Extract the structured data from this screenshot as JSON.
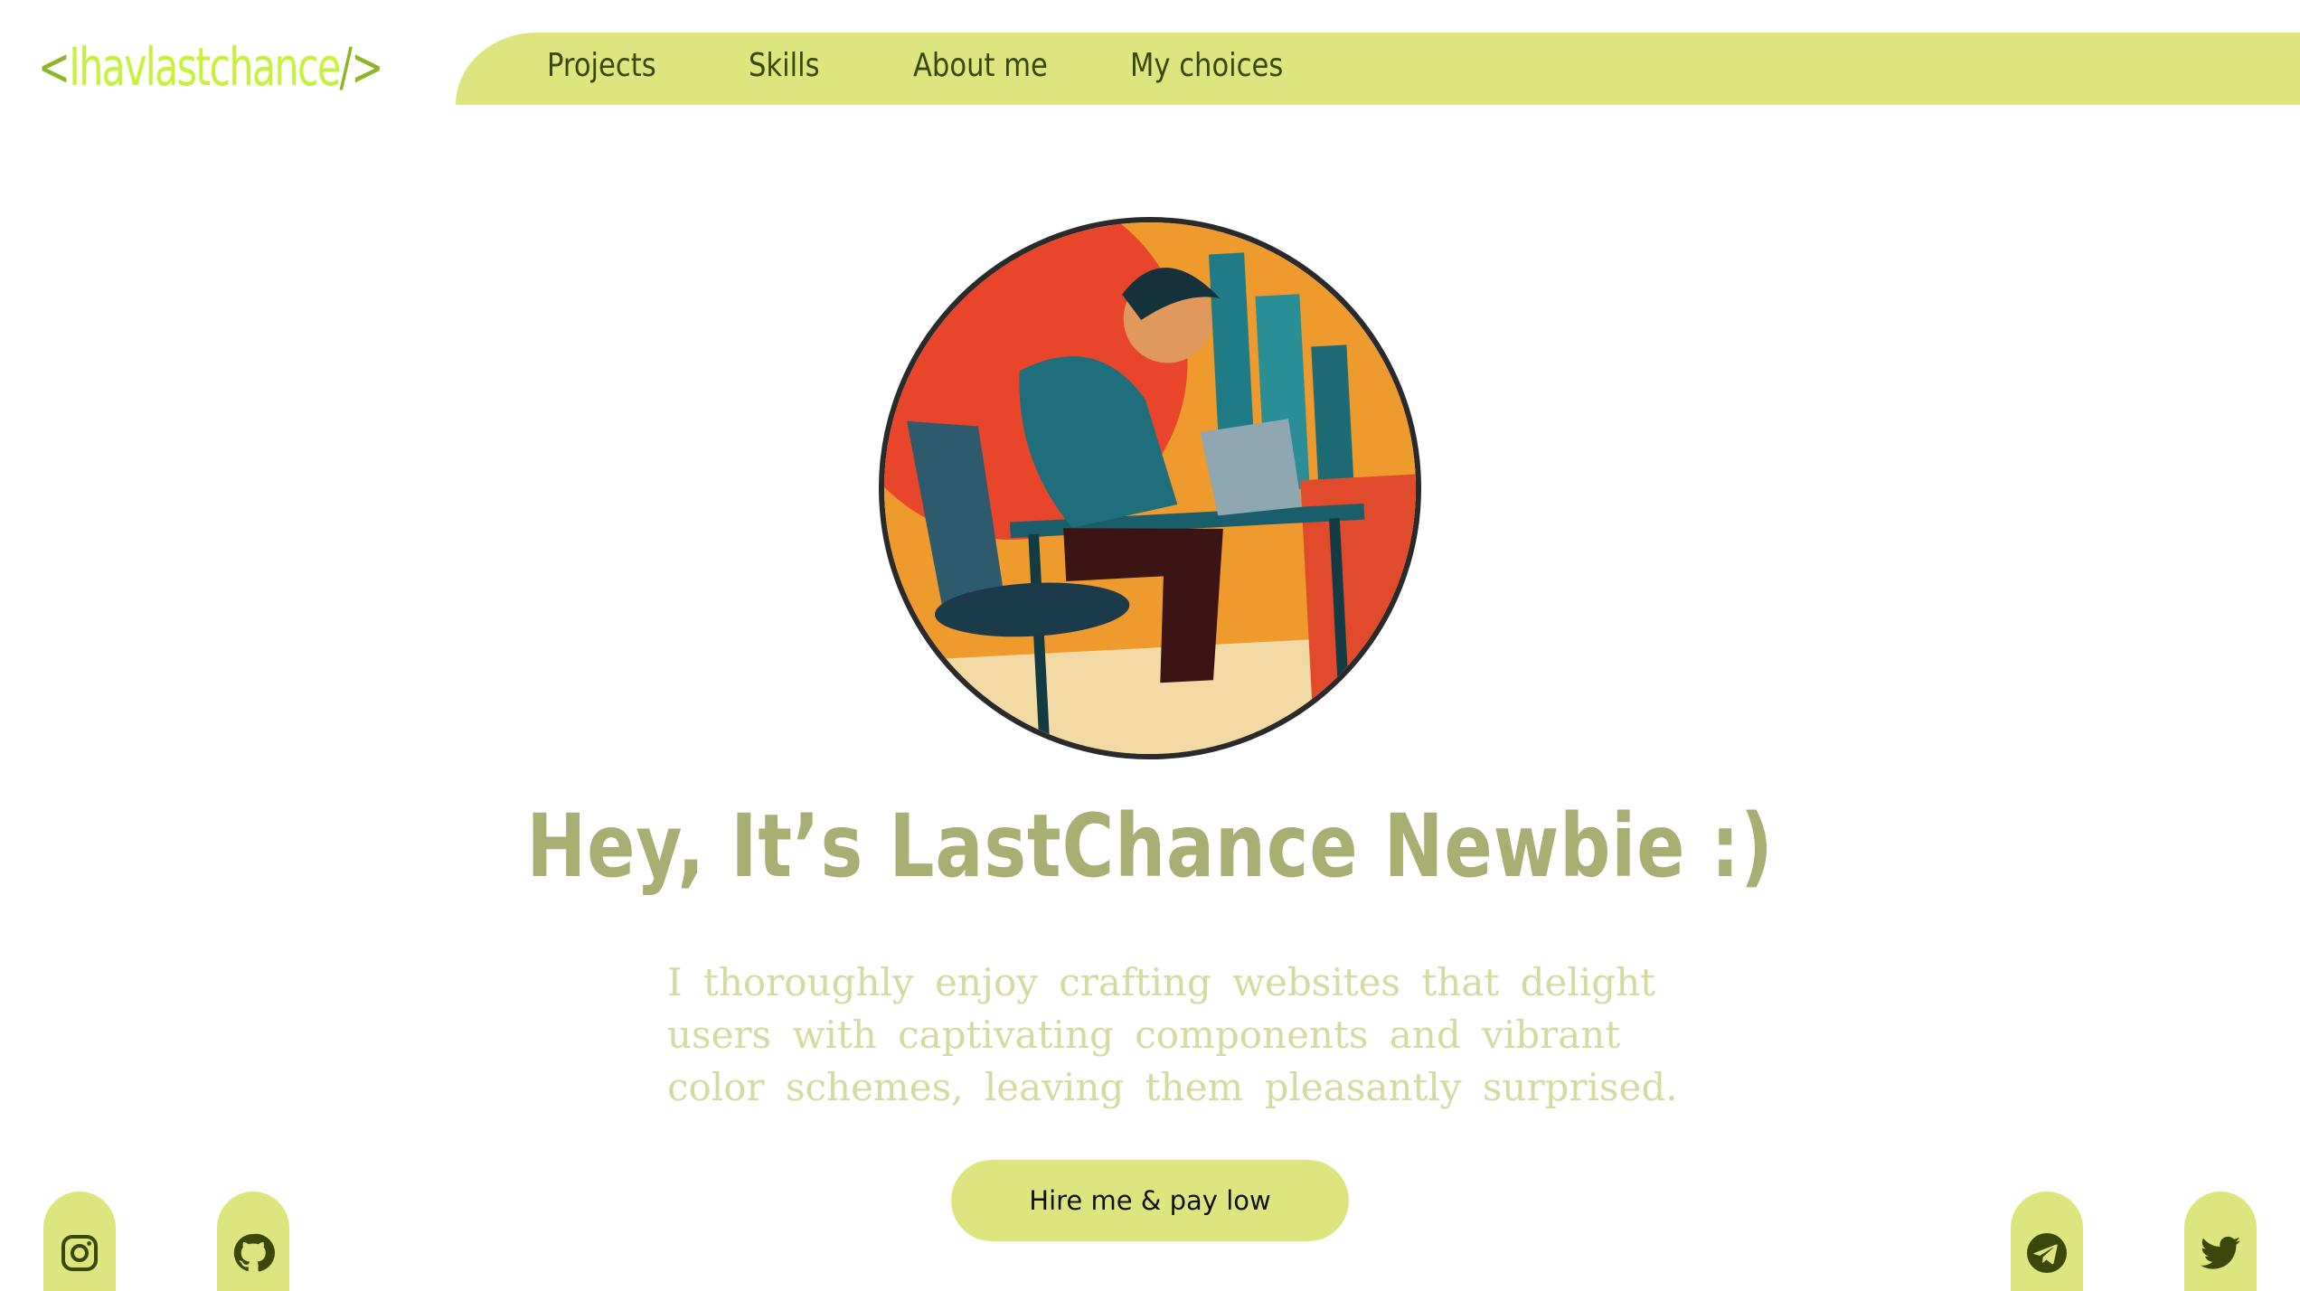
{
  "logo": {
    "open": "<",
    "name": "Ihavlastchance",
    "close": "/>"
  },
  "nav": {
    "items": [
      {
        "label": "Projects"
      },
      {
        "label": "Skills"
      },
      {
        "label": "About me"
      },
      {
        "label": "My choices"
      }
    ]
  },
  "hero": {
    "title": "Hey, It’s LastChance Newbie :)",
    "description": "I thoroughly enjoy crafting websites that delight users with captivating components and vibrant color schemes, leaving them pleasantly surprised.",
    "cta_label": "Hire me & pay low"
  },
  "social": [
    {
      "icon": "instagram-icon"
    },
    {
      "icon": "github-icon"
    },
    {
      "icon": "telegram-icon"
    },
    {
      "icon": "twitter-icon"
    }
  ],
  "colors": {
    "accent": "#dde67e",
    "logo": "#c6f23a",
    "nav_text": "#3b470b",
    "title": "#a9ae72",
    "text": "#d5dba0"
  }
}
